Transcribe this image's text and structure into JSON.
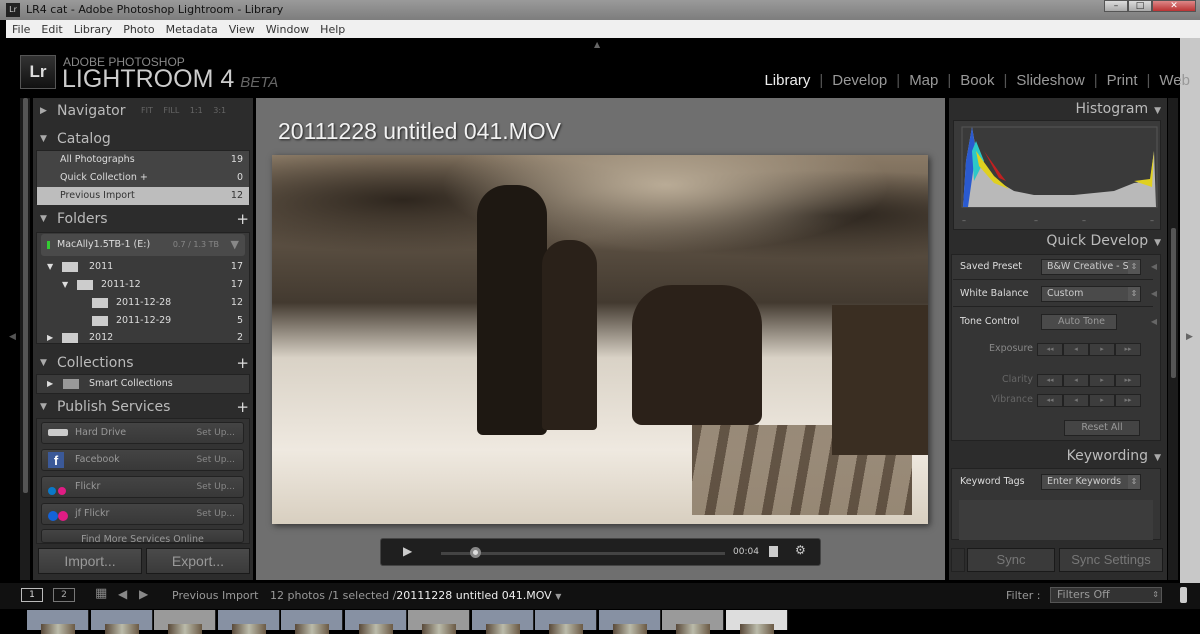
{
  "window": {
    "title": "LR4 cat - Adobe Photoshop Lightroom - Library",
    "controls": [
      "–",
      "□",
      "✕"
    ]
  },
  "menu": [
    "File",
    "Edit",
    "Library",
    "Photo",
    "Metadata",
    "View",
    "Window",
    "Help"
  ],
  "brand": {
    "logo": "Lr",
    "line1": "ADOBE PHOTOSHOP",
    "line2": "LIGHTROOM 4",
    "beta": "BETA"
  },
  "modules": [
    {
      "label": "Library",
      "active": true
    },
    {
      "label": "Develop"
    },
    {
      "label": "Map"
    },
    {
      "label": "Book"
    },
    {
      "label": "Slideshow"
    },
    {
      "label": "Print"
    },
    {
      "label": "Web"
    }
  ],
  "left": {
    "navigator": {
      "title": "Navigator",
      "zoom": [
        "FIT",
        "FILL",
        "1:1",
        "3:1"
      ]
    },
    "catalog": {
      "title": "Catalog",
      "items": [
        {
          "label": "All Photographs",
          "count": "19"
        },
        {
          "label": "Quick Collection +",
          "count": "0"
        },
        {
          "label": "Previous Import",
          "count": "12",
          "selected": true
        }
      ]
    },
    "folders": {
      "title": "Folders",
      "volume": {
        "label": "MacAlly1.5TB-1 (E:)",
        "usage": "0.7 / 1.3 TB"
      },
      "items": [
        {
          "label": "2011",
          "count": "17"
        },
        {
          "label": "2011-12",
          "count": "17"
        },
        {
          "label": "2011-12-28",
          "count": "12"
        },
        {
          "label": "2011-12-29",
          "count": "5"
        },
        {
          "label": "2012",
          "count": "2"
        }
      ]
    },
    "collections": {
      "title": "Collections",
      "items": [
        {
          "label": "Smart Collections"
        }
      ]
    },
    "publish": {
      "title": "Publish Services",
      "items": [
        {
          "label": "Hard Drive",
          "action": "Set Up..."
        },
        {
          "label": "Facebook",
          "action": "Set Up..."
        },
        {
          "label": "Flickr",
          "action": "Set Up..."
        },
        {
          "label": "jf Flickr",
          "action": "Set Up..."
        }
      ],
      "find_more": "Find More Services Online"
    },
    "import": "Import...",
    "export": "Export..."
  },
  "center": {
    "title": "20111228 untitled 041.MOV",
    "video": {
      "time": "00:04",
      "progress": 0.2
    }
  },
  "right": {
    "histogram": {
      "title": "Histogram"
    },
    "quick_develop": {
      "title": "Quick Develop",
      "saved_preset_label": "Saved Preset",
      "saved_preset": "B&W Creative - S...",
      "white_balance_label": "White Balance",
      "white_balance": "Custom",
      "tone_control_label": "Tone Control",
      "auto_tone": "Auto Tone",
      "exposure": "Exposure",
      "clarity": "Clarity",
      "vibrance": "Vibrance",
      "reset": "Reset All"
    },
    "keywording": {
      "title": "Keywording",
      "tags_label": "Keyword Tags",
      "tags_value": "Enter Keywords"
    },
    "sync": "Sync",
    "sync_settings": "Sync Settings"
  },
  "filmstrip": {
    "pages": [
      "1",
      "2"
    ],
    "source": "Previous Import",
    "summary": "12 photos /1 selected /",
    "selected_file": "20111228 untitled 041.MOV",
    "filter_label": "Filter :",
    "filter_value": "Filters Off",
    "thumbs": [
      0,
      0,
      0,
      0,
      0,
      0,
      0,
      0,
      0,
      0,
      0,
      1
    ]
  }
}
